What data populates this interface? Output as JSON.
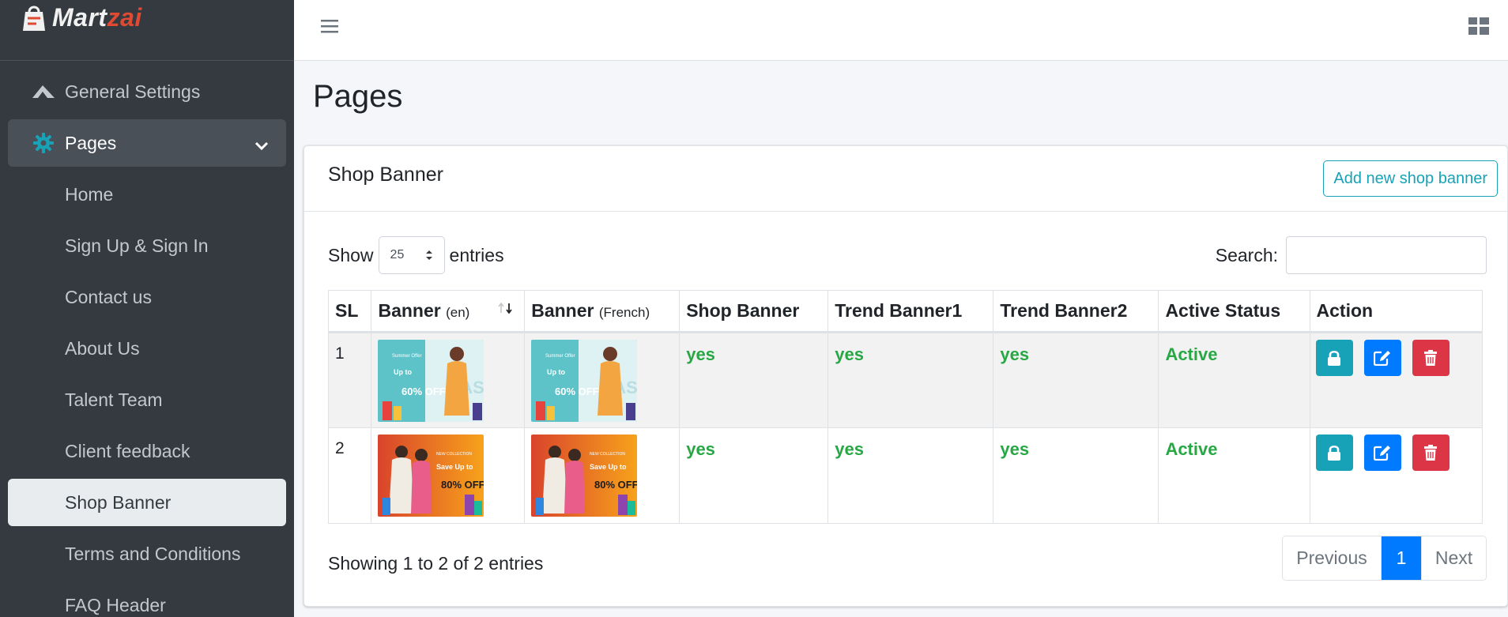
{
  "brand": {
    "name_part1": "Mart",
    "name_part2": "zai"
  },
  "sidebar": {
    "items": [
      {
        "label": "General Settings",
        "icon": "paper-plane-icon"
      },
      {
        "label": "Pages",
        "icon": "gear-icon"
      }
    ],
    "sub_items": [
      {
        "label": "Home"
      },
      {
        "label": "Sign Up & Sign In"
      },
      {
        "label": "Contact us"
      },
      {
        "label": "About Us"
      },
      {
        "label": "Talent Team"
      },
      {
        "label": "Client feedback"
      },
      {
        "label": "Shop Banner"
      },
      {
        "label": "Terms and Conditions"
      },
      {
        "label": "FAQ Header"
      }
    ]
  },
  "page": {
    "title": "Pages"
  },
  "card": {
    "title": "Shop Banner",
    "add_button": "Add new shop banner"
  },
  "controls": {
    "show_label": "Show",
    "entries_label": "entries",
    "page_size": "25",
    "search_label": "Search:"
  },
  "table": {
    "columns": [
      {
        "label": "SL",
        "sub": ""
      },
      {
        "label": "Banner",
        "sub": "(en)"
      },
      {
        "label": "Banner",
        "sub": "(French)"
      },
      {
        "label": "Shop Banner",
        "sub": ""
      },
      {
        "label": "Trend Banner1",
        "sub": ""
      },
      {
        "label": "Trend Banner2",
        "sub": ""
      },
      {
        "label": "Active Status",
        "sub": ""
      },
      {
        "label": "Action",
        "sub": ""
      }
    ],
    "rows": [
      {
        "sl": "1",
        "shop_banner": "yes",
        "trend1": "yes",
        "trend2": "yes",
        "status": "Active",
        "banner_style": "teal-fashion",
        "banner_text_top": "Summer Offer",
        "banner_text_mid": "Up to",
        "banner_text_big": "60% OFF",
        "banner_text_word": "FASHION"
      },
      {
        "sl": "2",
        "shop_banner": "yes",
        "trend1": "yes",
        "trend2": "yes",
        "status": "Active",
        "banner_style": "orange-collection",
        "banner_text_top": "NEW COLLECTION",
        "banner_text_mid": "Save Up to",
        "banner_text_big": "80% OFF",
        "banner_text_word": ""
      }
    ]
  },
  "footer": {
    "info": "Showing 1 to 2 of 2 entries",
    "prev": "Previous",
    "current": "1",
    "next": "Next"
  },
  "colors": {
    "sidebar_bg": "#343a40",
    "accent_info": "#17a2b8",
    "primary": "#007bff",
    "danger": "#dc3545",
    "success": "#28a745"
  }
}
